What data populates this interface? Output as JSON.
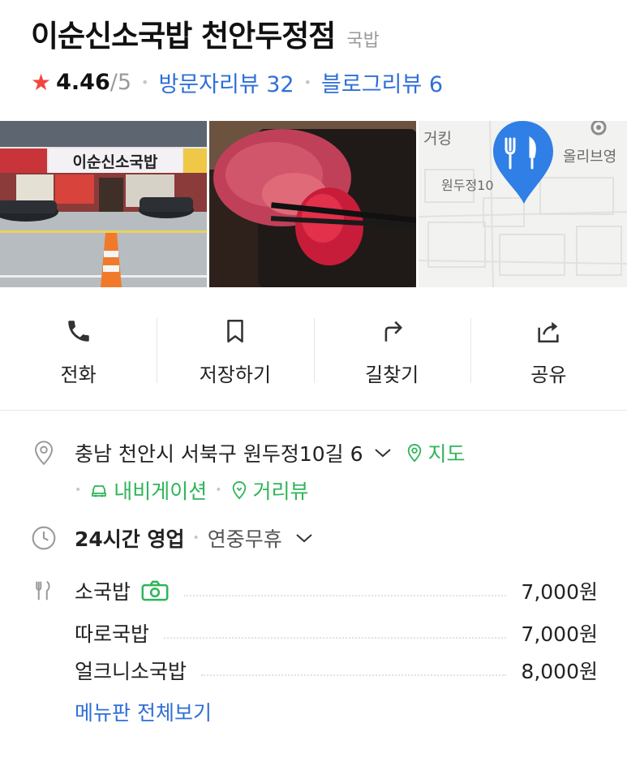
{
  "place": {
    "name": "이순신소국밥 천안두정점",
    "category": "국밥",
    "rating": "4.46",
    "rating_max": "/5",
    "visitor_reviews": "방문자리뷰 32",
    "blog_reviews": "블로그리뷰 6"
  },
  "photos": {
    "store_sign": "이순신소국밥",
    "map_label_1": "거킹",
    "map_label_2": "올리브영",
    "map_label_3": "원두정10"
  },
  "actions": [
    {
      "label": "전화",
      "icon": "phone-icon"
    },
    {
      "label": "저장하기",
      "icon": "bookmark-icon"
    },
    {
      "label": "길찾기",
      "icon": "directions-icon"
    },
    {
      "label": "공유",
      "icon": "share-icon"
    }
  ],
  "address": {
    "text": "충남 천안시 서북구 원두정10길 6",
    "map_link": "지도",
    "navigation": "내비게이션",
    "street_view": "거리뷰"
  },
  "hours": {
    "status": "24시간 영업",
    "note": "연중무휴"
  },
  "menu": {
    "items": [
      {
        "name": "소국밥",
        "price": "7,000원"
      },
      {
        "name": "따로국밥",
        "price": "7,000원"
      },
      {
        "name": "얼크니소국밥",
        "price": "8,000원"
      }
    ],
    "see_all": "메뉴판 전체보기"
  },
  "colors": {
    "accent_blue": "#2f6fd8",
    "accent_green": "#2fb55a",
    "star_red": "#f2453d"
  }
}
